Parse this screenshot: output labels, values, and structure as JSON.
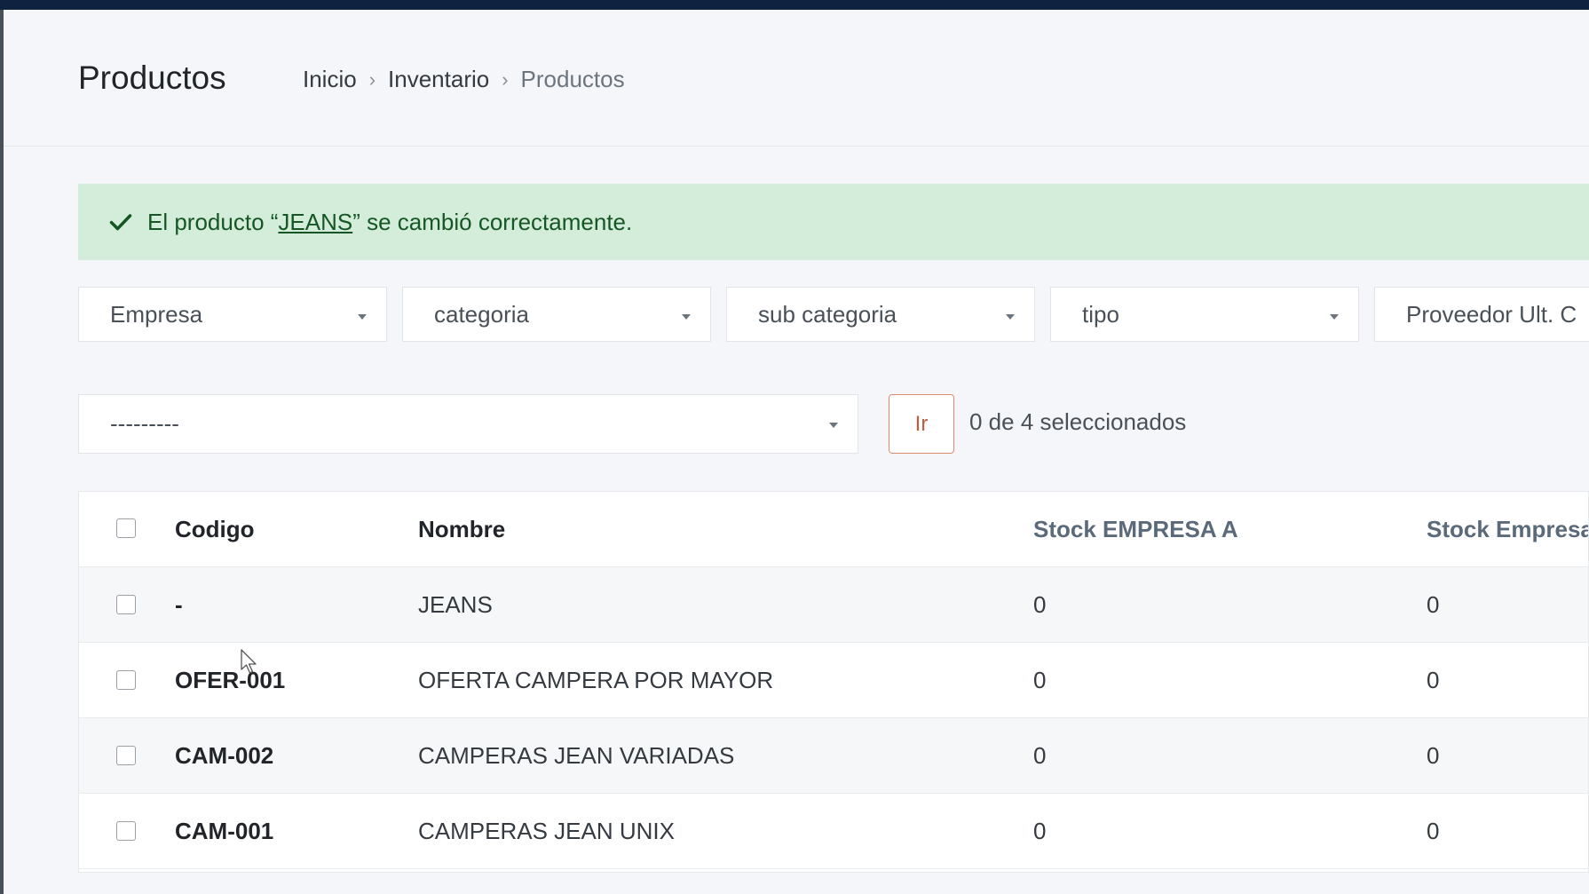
{
  "header": {
    "title": "Productos",
    "breadcrumb": [
      "Inicio",
      "Inventario",
      "Productos"
    ]
  },
  "alert": {
    "prefix": "El producto “",
    "link_text": "JEANS",
    "suffix": "” se cambió correctamente.",
    "color": "#d4edda"
  },
  "filters": [
    "Empresa",
    "categoria",
    "sub categoria",
    "tipo",
    "Proveedor Ult. C"
  ],
  "actions": {
    "select_value": "---------",
    "go_label": "Ir",
    "selected_text": "0 de 4 seleccionados"
  },
  "table": {
    "columns": [
      "Codigo",
      "Nombre",
      "Stock EMPRESA A",
      "Stock Empresa"
    ],
    "rows": [
      {
        "code": "-",
        "name": "JEANS",
        "stock_a": "0",
        "stock_b": "0"
      },
      {
        "code": "OFER-001",
        "name": "OFERTA CAMPERA POR MAYOR",
        "stock_a": "0",
        "stock_b": "0"
      },
      {
        "code": "CAM-002",
        "name": "CAMPERAS JEAN VARIADAS",
        "stock_a": "0",
        "stock_b": "0"
      },
      {
        "code": "CAM-001",
        "name": "CAMPERAS JEAN UNIX",
        "stock_a": "0",
        "stock_b": "0"
      }
    ]
  },
  "colors": {
    "topbar": "#0f2340",
    "success_bg": "#d4edda",
    "go_button_border": "#e08a6e"
  },
  "icons": {
    "alert": "check-icon",
    "dropdown": "caret-down-icon",
    "cursor": "mouse-pointer-icon"
  }
}
